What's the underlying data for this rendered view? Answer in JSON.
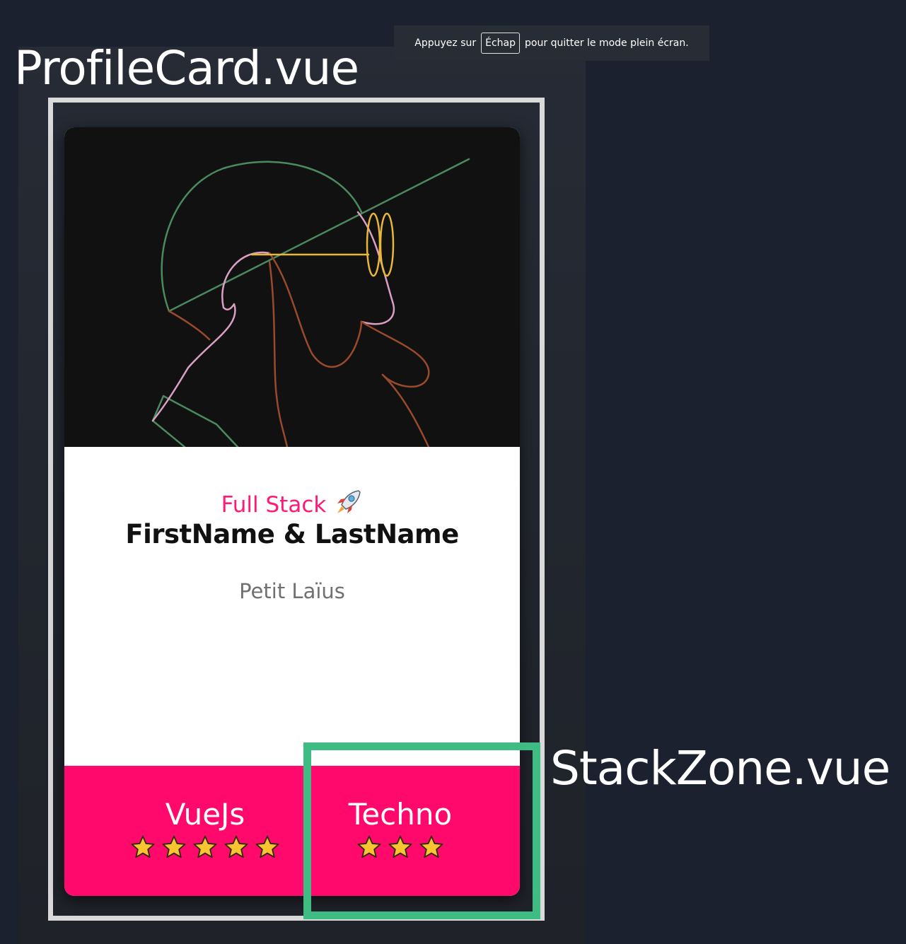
{
  "banner": {
    "prefix": "Appuyez sur",
    "key": "Échap",
    "suffix": "pour quitter le mode plein écran."
  },
  "labels": {
    "profile_card": "ProfileCard.vue",
    "stack_zone": "StackZone.vue"
  },
  "card": {
    "role": "Full Stack",
    "name": "FirstName & LastName",
    "bio": "Petit Laïus",
    "stacks": [
      {
        "name": "VueJs",
        "rating": 5
      },
      {
        "name": "Techno",
        "rating": 3
      }
    ]
  },
  "colors": {
    "background": "#1c2130",
    "role_pink": "#ff1a76",
    "footer_pink": "#ff0a6c",
    "highlight_green": "#3fbb84",
    "star_gold": "#f7c531"
  },
  "icons": {
    "rocket": "rocket-icon",
    "star": "star-icon"
  }
}
